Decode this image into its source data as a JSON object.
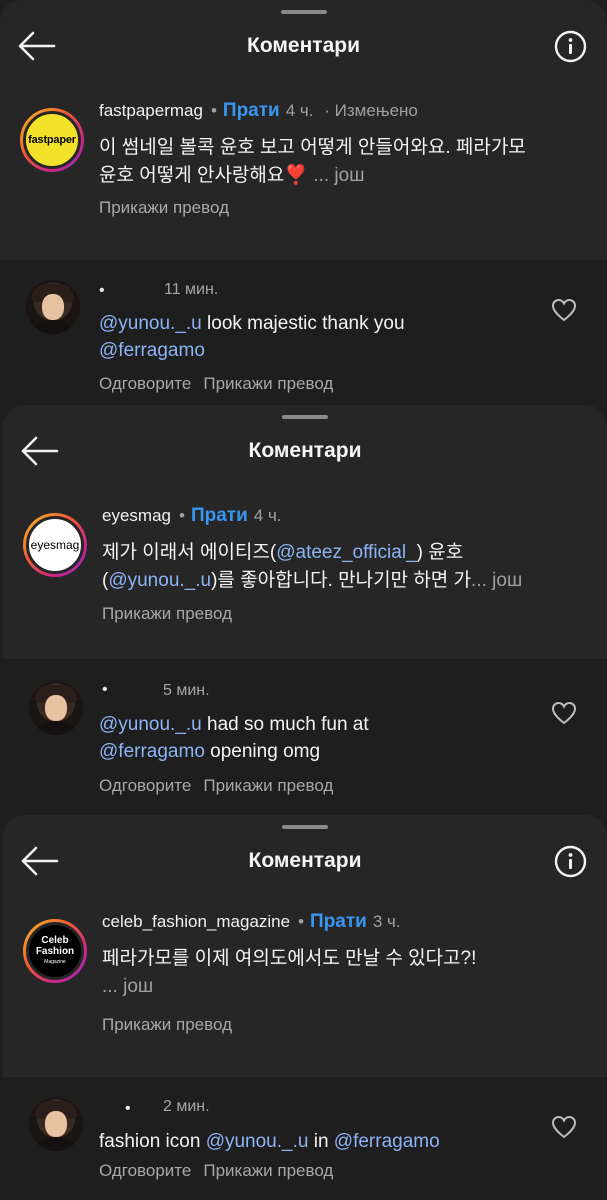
{
  "screens": [
    {
      "title": "Коментари",
      "post": {
        "username": "fastpapermag",
        "logo_text": "fastpaper",
        "follow": "Прати",
        "time": "4 ч.",
        "edited": "· Измењено",
        "text_line1": "이 썸네일 볼콕 윤호 보고 어떻게 안들어와요. 페라가모",
        "text_line2": "윤호 어떻게 안사랑해요",
        "emoji": "❣️",
        "more": " ... још",
        "translate": "Прикажи превод"
      },
      "reply": {
        "dot": "•",
        "time": "11 мин.",
        "mention1": "@yunou._.u",
        "text1": "  look majestic thank you",
        "mention2": "@ferragamo",
        "reply_label": "Одговорите",
        "translate": "Прикажи превод"
      }
    },
    {
      "title": "Коментари",
      "post": {
        "username": "eyesmag",
        "logo_text": "eyesmag",
        "follow": "Прати",
        "time": "4 ч.",
        "text_a": "제가 이래서 에이티즈(",
        "mention_a": "@ateez_official_",
        "text_b": ") 윤호",
        "text_c": "(",
        "mention_b": "@yunou._.u",
        "text_d": ")를 좋아합니다. 만나기만 하면 가",
        "more": "... још",
        "translate": "Прикажи превод"
      },
      "reply": {
        "dot": "•",
        "time": "5 мин.",
        "mention1": "@yunou._.u",
        "text1": " had so much fun at",
        "mention2": "@ferragamo",
        "text2": " opening omg",
        "reply_label": "Одговорите",
        "translate": "Прикажи превод"
      }
    },
    {
      "title": "Коментари",
      "post": {
        "username": "celeb_fashion_magazine",
        "logo_line1": "Celeb",
        "logo_line2": "Fashion",
        "logo_line3": "Magazine",
        "follow": "Прати",
        "time": "3 ч.",
        "text": "페라가모를 이제 여의도에서도 만날 수 있다고?!",
        "more": "... још",
        "translate": "Прикажи превод"
      },
      "reply": {
        "dot": "•",
        "time": "2 мин.",
        "text_a": "fashion icon ",
        "mention1": "@yunou._.u",
        "text_b": " in ",
        "mention2": "@ferragamo",
        "reply_label": "Одговорите",
        "translate": "Прикажи превод"
      }
    }
  ],
  "colors": {
    "accent": "#3897f0",
    "mention": "#8cb4f5",
    "background": "#262626",
    "reply_bg": "#1e1e1e"
  },
  "icons": [
    "back-arrow-icon",
    "info-icon",
    "heart-icon"
  ]
}
